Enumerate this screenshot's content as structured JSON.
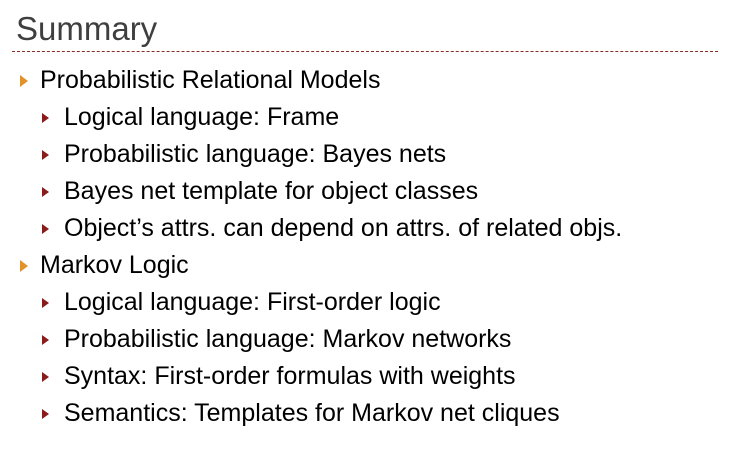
{
  "slide": {
    "title": "Summary",
    "accent_color": "#e3922a",
    "sub_bullet_color": "#8b1a1a",
    "rule_color": "#8b2a2a",
    "bullets": [
      {
        "text": "Probabilistic Relational Models",
        "children": [
          "Logical language: Frame",
          "Probabilistic language: Bayes nets",
          "Bayes net template for object classes",
          "Object’s attrs. can depend on attrs. of related objs."
        ]
      },
      {
        "text": "Markov Logic",
        "children": [
          "Logical language: First-order logic",
          "Probabilistic language: Markov networks",
          "Syntax: First-order formulas with weights",
          "Semantics: Templates for Markov net cliques"
        ]
      }
    ]
  }
}
